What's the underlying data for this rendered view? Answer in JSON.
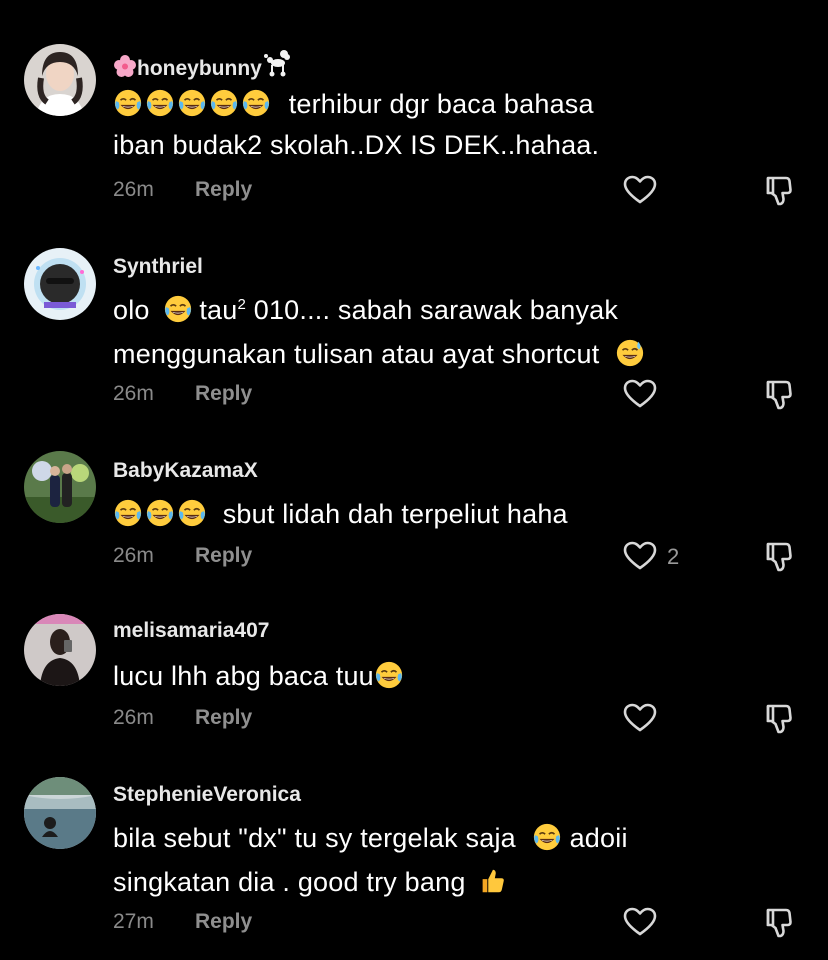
{
  "colors": {
    "background": "#000000",
    "username": "#e8e8e8",
    "meta": "#8a8a8a",
    "icon": "#d8d8d8"
  },
  "comments": [
    {
      "username": "honeybunny",
      "username_prefix_icon": "cherry-blossom-icon",
      "username_suffix_icon": "poodle-icon",
      "lines": [
        "terhibur dgr baca bahasa",
        "iban budak2 skolah..DX IS DEK..hahaa."
      ],
      "leading_emojis": [
        "tears-of-joy-icon",
        "tears-of-joy-icon",
        "tears-of-joy-icon",
        "tears-of-joy-icon",
        "tears-of-joy-icon"
      ],
      "time": "26m",
      "reply": "Reply",
      "likes": ""
    },
    {
      "username": "Synthriel",
      "line1_a": "olo",
      "line1_b": "tau",
      "line1_sup": "2",
      "line1_c": "010.... sabah sarawak banyak",
      "line2": "menggunakan tulisan atau ayat shortcut",
      "emojis": [
        "tears-of-joy-icon",
        "grinning-sweat-icon"
      ],
      "time": "26m",
      "reply": "Reply",
      "likes": ""
    },
    {
      "username": "BabyKazamaX",
      "line1": "sbut lidah dah terpeliut haha",
      "leading_emojis": [
        "tears-of-joy-icon",
        "tears-of-joy-icon",
        "tears-of-joy-icon"
      ],
      "time": "26m",
      "reply": "Reply",
      "likes": "2"
    },
    {
      "username": "melisamaria407",
      "line1": "lucu lhh abg baca tuu",
      "emojis": [
        "tears-of-joy-icon"
      ],
      "time": "26m",
      "reply": "Reply",
      "likes": ""
    },
    {
      "username": "StephenieVeronica",
      "line1_a": "bila sebut \"dx\" tu sy tergelak saja",
      "line1_b": "adoii",
      "line2": "singkatan dia . good try bang",
      "emojis": [
        "tears-of-joy-icon",
        "thumbs-up-icon"
      ],
      "time": "27m",
      "reply": "Reply",
      "likes": ""
    }
  ]
}
